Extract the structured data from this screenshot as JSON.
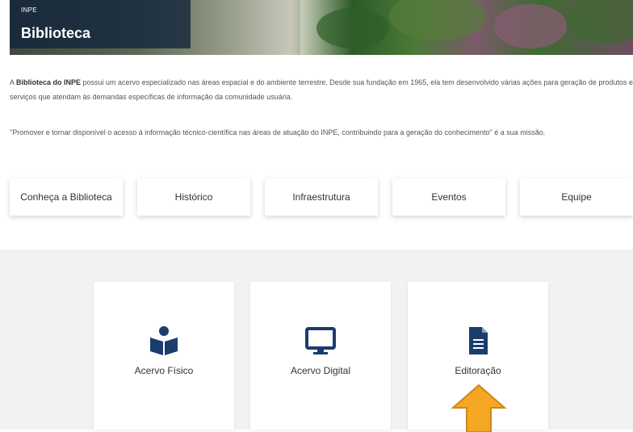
{
  "hero": {
    "org": "INPE",
    "title": "Biblioteca"
  },
  "intro": {
    "p1_prefix": "A ",
    "p1_bold": "Biblioteca do INPE",
    "p1_rest": " possui um acervo especializado nas áreas espacial e do ambiente terrestre. Desde sua fundação em 1965, ela tem desenvolvido várias ações para geração de produtos e serviços que atendam às demandas específicas de informação da comunidade usuária.",
    "p2": "\"Promover e tornar disponível o acesso à informação técnico-científica nas áreas de atuação do INPE, contribuindo para a geração do conhecimento\" é a sua missão."
  },
  "nav": {
    "items": [
      {
        "label": "Conheça a Biblioteca"
      },
      {
        "label": "Histórico"
      },
      {
        "label": "Infraestrutura"
      },
      {
        "label": "Eventos"
      },
      {
        "label": "Equipe"
      }
    ]
  },
  "cards": [
    {
      "label": "Acervo Físico",
      "icon": "book-reader-icon"
    },
    {
      "label": "Acervo Digital",
      "icon": "monitor-icon"
    },
    {
      "label": "Editoração",
      "icon": "document-icon"
    }
  ],
  "colors": {
    "icon": "#1a3d6d",
    "arrow_fill": "#f5a623",
    "arrow_stroke": "#c98a1a",
    "panel": "#f2f2f2"
  }
}
